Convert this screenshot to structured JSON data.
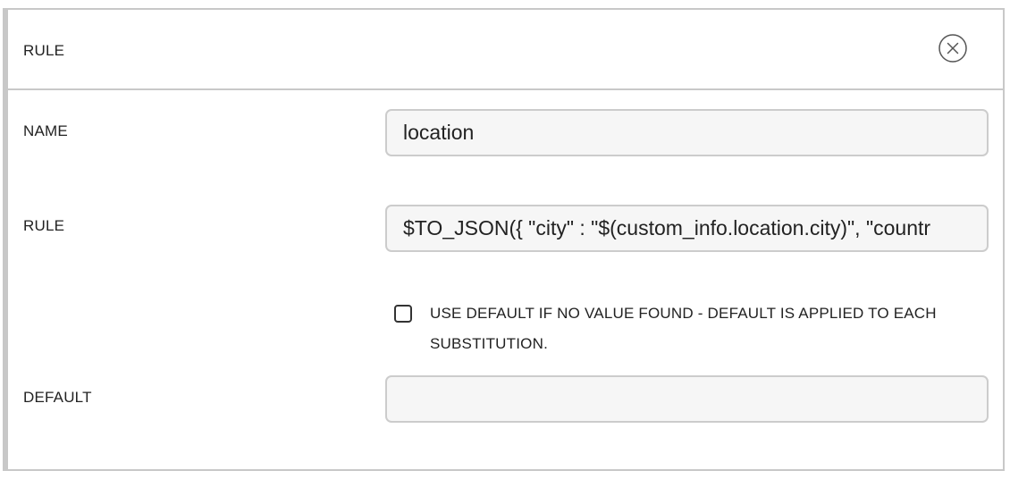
{
  "header": {
    "title": "RULE"
  },
  "fields": {
    "name": {
      "label": "NAME",
      "value": "location"
    },
    "rule": {
      "label": "RULE",
      "value": "$TO_JSON({ \"city\" : \"$(custom_info.location.city)\", \"countr"
    },
    "use_default": {
      "label": "USE DEFAULT IF NO VALUE FOUND - DEFAULT IS APPLIED TO EACH SUBSTITUTION.",
      "checked": false
    },
    "default": {
      "label": "DEFAULT",
      "value": ""
    }
  },
  "colors": {
    "border": "#c8c8c8",
    "field_border": "#cccccc",
    "field_background": "#f6f6f6",
    "text": "#222222"
  }
}
